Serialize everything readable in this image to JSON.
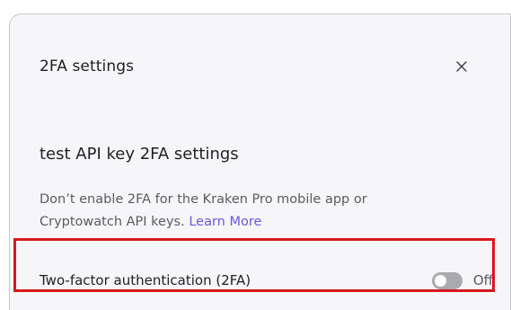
{
  "modal": {
    "title": "2FA settings",
    "close_icon": "close-icon"
  },
  "section": {
    "title": "test API key 2FA settings",
    "description_line1": "Don’t enable 2FA for the Kraken Pro mobile app or",
    "description_line2": "Cryptowatch API keys.",
    "learn_more": "Learn More"
  },
  "setting": {
    "label": "Two-factor authentication (2FA)",
    "toggle_state": "Off",
    "toggle_on": false
  },
  "colors": {
    "link": "#6f53ea",
    "highlight": "#d7191c",
    "toggle_off": "#a9a9b1"
  }
}
